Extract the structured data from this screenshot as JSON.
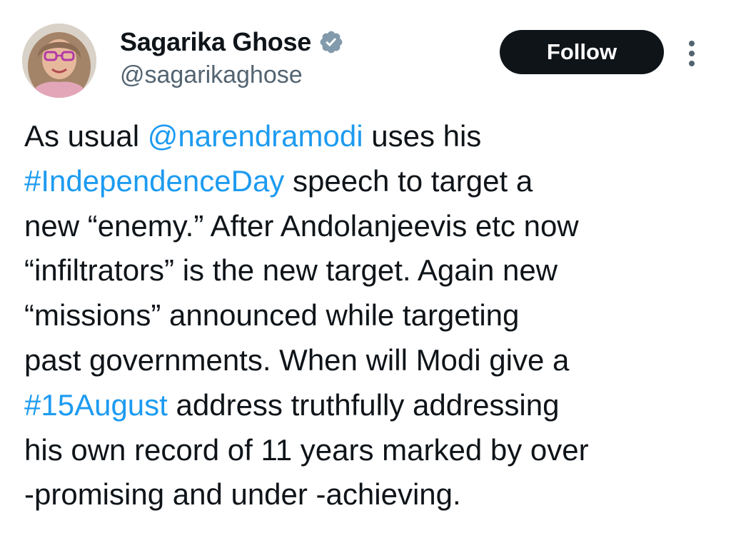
{
  "author": {
    "display_name": "Sagarika Ghose",
    "handle": "@sagarikaghose",
    "verified": true
  },
  "actions": {
    "follow_label": "Follow",
    "more_icon": "more-vertical-icon"
  },
  "tweet": {
    "lines": [
      [
        {
          "t": "As usual "
        },
        {
          "t": "@narendramodi",
          "type": "mention"
        },
        {
          "t": " uses his"
        }
      ],
      [
        {
          "t": "#IndependenceDay",
          "type": "hashtag"
        },
        {
          "t": " speech to target a"
        }
      ],
      [
        {
          "t": "new “enemy.” After Andolanjeevis etc now"
        }
      ],
      [
        {
          "t": "“infiltrators” is the new target. Again new"
        }
      ],
      [
        {
          "t": "“missions” announced while targeting"
        }
      ],
      [
        {
          "t": "past governments. When will Modi give a"
        }
      ],
      [
        {
          "t": "#15August",
          "type": "hashtag"
        },
        {
          "t": " address truthfully addressing"
        }
      ],
      [
        {
          "t": "his own record of 11 years marked by over"
        }
      ],
      [
        {
          "t": "-promising and under -achieving."
        }
      ]
    ]
  },
  "colors": {
    "link": "#1d9bf0",
    "text": "#0f1419",
    "secondary": "#536471",
    "button_bg": "#0f1419",
    "button_text": "#ffffff",
    "verified_badge": "#829aab"
  }
}
